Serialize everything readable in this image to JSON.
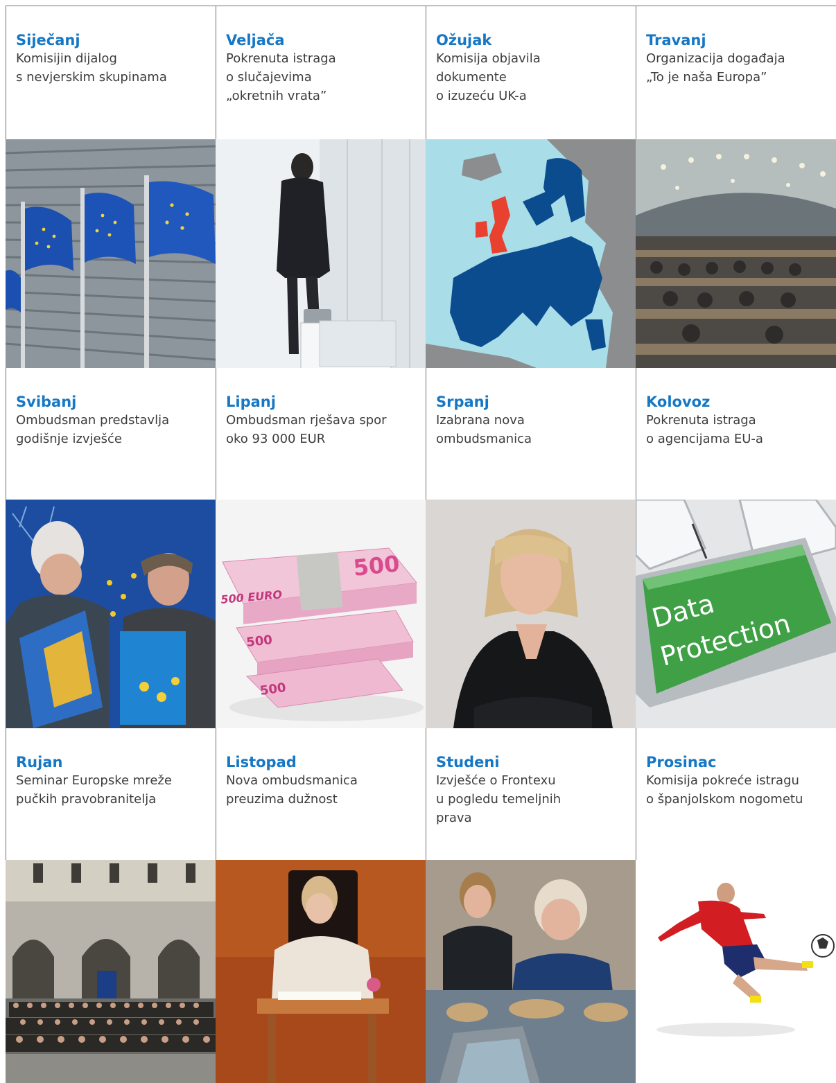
{
  "timeline": [
    {
      "month": "Siječanj",
      "desc": "Komisijin dijalog\ns nevjerskim skupinama",
      "image": "eu-flags-building"
    },
    {
      "month": "Veljača",
      "desc": "Pokrenuta istraga\no slučajevima\n„okretnih vrata”",
      "image": "businessman-walking"
    },
    {
      "month": "Ožujak",
      "desc": "Komisija objavila\ndokumente\no izuzeću UK-a",
      "image": "europe-map"
    },
    {
      "month": "Travanj",
      "desc": "Organizacija događaja\n„To je naša Europa”",
      "image": "parliament-hall"
    },
    {
      "month": "Svibanj",
      "desc": "Ombudsman predstavlja\ngodišnje izvješće",
      "image": "ombudsman-report"
    },
    {
      "month": "Lipanj",
      "desc": "Ombudsman rješava spor\noko 93 000 EUR",
      "image": "euro-banknotes"
    },
    {
      "month": "Srpanj",
      "desc": "Izabrana nova\nombudsmanica",
      "image": "new-ombudswoman-portrait"
    },
    {
      "month": "Kolovoz",
      "desc": "Pokrenuta istraga\no agencijama EU-a",
      "image": "data-protection-key"
    },
    {
      "month": "Rujan",
      "desc": "Seminar Europske mreže\npučkih pravobranitelja",
      "image": "group-photo-seminar"
    },
    {
      "month": "Listopad",
      "desc": "Nova ombudsmanica\npreuzima dužnost",
      "image": "signing-oath"
    },
    {
      "month": "Studeni",
      "desc": "Izvješće o Frontexu\nu pogledu temeljnih\nprava",
      "image": "hearing-meeting"
    },
    {
      "month": "Prosinac",
      "desc": "Komisija pokreće istragu\no španjolskom nogometu",
      "image": "football-player"
    }
  ],
  "image_text": {
    "banknote": "500",
    "banknote_label": "500 EURO",
    "key_line1": "Data",
    "key_line2": "Protection"
  },
  "colors": {
    "month_blue": "#1677c4",
    "eu_blue": "#003f8f",
    "map_red": "#e8412f",
    "key_green": "#3fa046"
  }
}
